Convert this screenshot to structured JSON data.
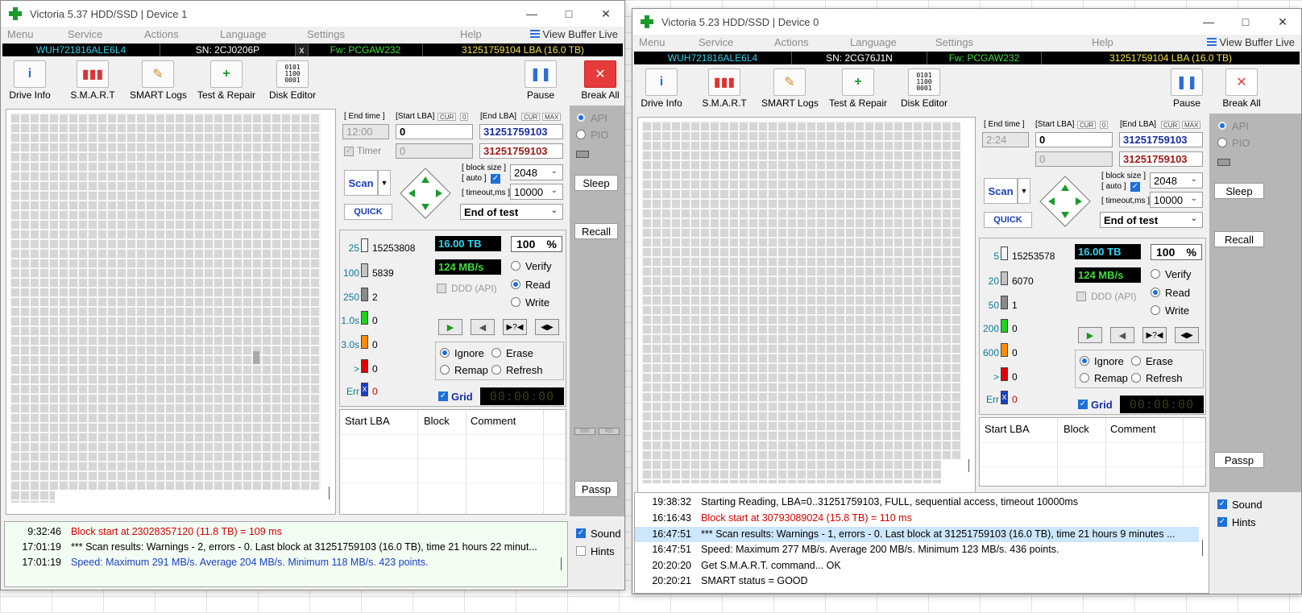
{
  "w1": {
    "title": "Victoria 5.37 HDD/SSD | Device 1",
    "menu": [
      "Menu",
      "Service",
      "Actions",
      "Language",
      "Settings",
      "Help"
    ],
    "view_buffer": "View Buffer Live",
    "info": {
      "model": "WUH721816ALE6L4",
      "sn": "SN: 2CJ0206P",
      "close": "x",
      "fw": "Fw: PCGAW232",
      "lba": "31251759104 LBA (16.0 TB)"
    },
    "toolbar": [
      "Drive Info",
      "S.M.A.R.T",
      "SMART Logs",
      "Test & Repair",
      "Disk Editor"
    ],
    "pause": "Pause",
    "break_all": "Break All",
    "labels": {
      "end_time": "[ End time ]",
      "start_lba": "[Start LBA]",
      "cur": "CUR",
      "zero": "0",
      "end_lba": "[End LBA]",
      "max": "MAX",
      "timer": "Timer",
      "block_size": "[ block size ]",
      "auto": "[ auto ]",
      "timeout": "[ timeout,ms ]"
    },
    "end_time_value": "12:00",
    "start_lba": "0",
    "end_lba": "31251759103",
    "start_lba2": "0",
    "end_lba2": "31251759103",
    "block_size": "2048",
    "timeout": "10000",
    "scan": "Scan",
    "quick": "QUICK",
    "end_of_test": "End of test",
    "api": "API",
    "pio": "PIO",
    "sleep": "Sleep",
    "recall": "Recall",
    "passp": "Passp",
    "wr": "WR",
    "rd": "RD",
    "legend": [
      {
        "label": "25",
        "count": "15253808",
        "color": "#f4f4f4"
      },
      {
        "label": "100",
        "count": "5839",
        "color": "#c4c4c4"
      },
      {
        "label": "250",
        "count": "2",
        "color": "#8a8a8a"
      },
      {
        "label": "1.0s",
        "count": "0",
        "color": "#1fd11f"
      },
      {
        "label": "3.0s",
        "count": "0",
        "color": "#ff8c00"
      },
      {
        "label": ">",
        "count": "0",
        "color": "#e00000"
      },
      {
        "label": "Err",
        "count": "0",
        "color": "#1a3fc2"
      }
    ],
    "err_mark": "x",
    "capacity": "16.00 TB",
    "percent": "100",
    "pct_sign": "%",
    "speed": "124 MB/s",
    "ddd": "DDD (API)",
    "verify": "Verify",
    "read": "Read",
    "write": "Write",
    "ignore": "Ignore",
    "erase": "Erase",
    "remap": "Remap",
    "refresh": "Refresh",
    "grid": "Grid",
    "timer_display": "00:00:00",
    "table_headers": [
      "Start LBA",
      "Block",
      "Comment"
    ],
    "sound": "Sound",
    "hints": "Hints",
    "log": [
      {
        "time": "9:32:46",
        "text": "Block start at 23028357120 (11.8 TB)  = 109 ms",
        "color": "#d40000"
      },
      {
        "time": "17:01:19",
        "text": "*** Scan results: Warnings - 2, errors - 0. Last block at 31251759103 (16.0 TB), time 21 hours 22 minut...",
        "color": "#000000"
      },
      {
        "time": "17:01:19",
        "text": "Speed: Maximum 291 MB/s. Average 204 MB/s. Minimum 118 MB/s. 423 points.",
        "color": "#1a3fc2"
      }
    ]
  },
  "w2": {
    "title": "Victoria 5.23 HDD/SSD | Device 0",
    "menu": [
      "Menu",
      "Service",
      "Actions",
      "Language",
      "Settings",
      "Help"
    ],
    "view_buffer": "View Buffer Live",
    "info": {
      "model": "WUH721816ALE6L4",
      "sn": "SN: 2CG76J1N",
      "fw": "Fw: PCGAW232",
      "lba": "31251759104 LBA (16.0 TB)"
    },
    "toolbar": [
      "Drive Info",
      "S.M.A.R.T",
      "SMART Logs",
      "Test & Repair",
      "Disk Editor"
    ],
    "pause": "Pause",
    "break_all": "Break All",
    "labels": {
      "end_time": "[ End time ]",
      "start_lba": "[Start LBA]",
      "cur": "CUR",
      "zero": "0",
      "end_lba": "[End LBA]",
      "max": "MAX",
      "block_size": "[ block size ]",
      "auto": "[ auto ]",
      "timeout": "[ timeout,ms ]"
    },
    "end_time_value": "2:24",
    "start_lba": "0",
    "end_lba": "31251759103",
    "start_lba2": "0",
    "end_lba2": "31251759103",
    "block_size": "2048",
    "timeout": "10000",
    "scan": "Scan",
    "quick": "QUICK",
    "end_of_test": "End of test",
    "api": "API",
    "pio": "PIO",
    "sleep": "Sleep",
    "recall": "Recall",
    "passp": "Passp",
    "legend": [
      {
        "label": "5",
        "count": "15253578",
        "color": "#f4f4f4"
      },
      {
        "label": "20",
        "count": "6070",
        "color": "#c4c4c4"
      },
      {
        "label": "50",
        "count": "1",
        "color": "#8a8a8a"
      },
      {
        "label": "200",
        "count": "0",
        "color": "#1fd11f"
      },
      {
        "label": "600",
        "count": "0",
        "color": "#ff8c00"
      },
      {
        "label": ">",
        "count": "0",
        "color": "#e00000"
      },
      {
        "label": "Err",
        "count": "0",
        "color": "#1a3fc2"
      }
    ],
    "err_mark": "x",
    "capacity": "16.00 TB",
    "percent": "100",
    "pct_sign": "%",
    "speed": "124 MB/s",
    "ddd": "DDD (API)",
    "verify": "Verify",
    "read": "Read",
    "write": "Write",
    "ignore": "Ignore",
    "erase": "Erase",
    "remap": "Remap",
    "refresh": "Refresh",
    "grid": "Grid",
    "timer_display": "00:00:00",
    "table_headers": [
      "Start LBA",
      "Block",
      "Comment"
    ],
    "sound": "Sound",
    "hints": "Hints",
    "log": [
      {
        "time": "19:38:32",
        "text": "Starting Reading, LBA=0..31251759103, FULL, sequential access, timeout 10000ms",
        "color": "#000000"
      },
      {
        "time": "16:16:43",
        "text": "Block start at 30793089024 (15.8 TB)  = 110 ms",
        "color": "#d40000"
      },
      {
        "time": "16:47:51",
        "text": "*** Scan results: Warnings - 1, errors - 0. Last block at 31251759103 (16.0 TB), time 21 hours 9 minutes ...",
        "color": "#000000"
      },
      {
        "time": "16:47:51",
        "text": "Speed: Maximum 277 MB/s. Average 200 MB/s. Minimum 123 MB/s. 436 points.",
        "color": "#000000"
      },
      {
        "time": "20:20:20",
        "text": "Get S.M.A.R.T. command... OK",
        "color": "#000000"
      },
      {
        "time": "20:20:21",
        "text": "SMART status = GOOD",
        "color": "#000000"
      }
    ]
  }
}
